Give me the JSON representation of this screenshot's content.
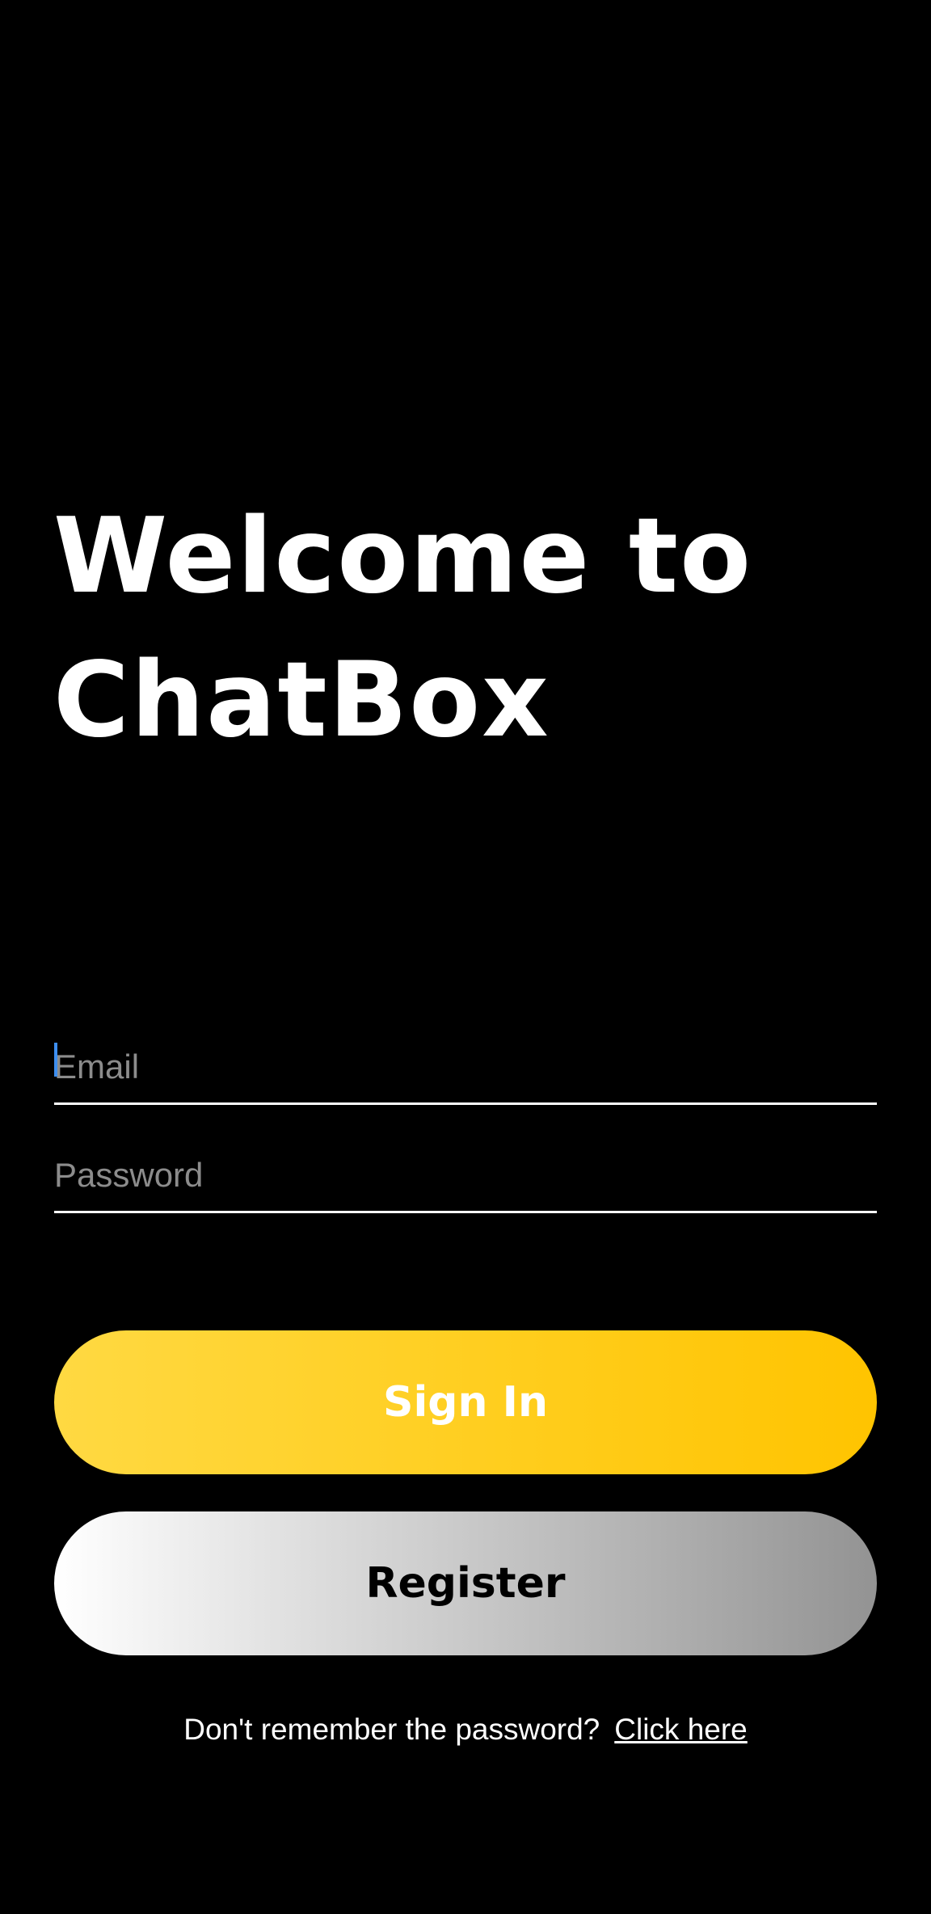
{
  "welcome": {
    "line1": "Welcome to",
    "line2": "ChatBox"
  },
  "form": {
    "email_placeholder": "Email",
    "password_placeholder": "Password"
  },
  "buttons": {
    "sign_in_label": "Sign In",
    "register_label": "Register"
  },
  "help": {
    "prompt_text": "Don't remember the password?",
    "link_text": "Click here"
  },
  "colors": {
    "background": "#000000",
    "sign_in_gradient_start": "#ffd942",
    "sign_in_gradient_end": "#ffc400",
    "register_gradient_start": "#ffffff",
    "register_gradient_end": "#939393",
    "caret": "#3d8ef0"
  }
}
